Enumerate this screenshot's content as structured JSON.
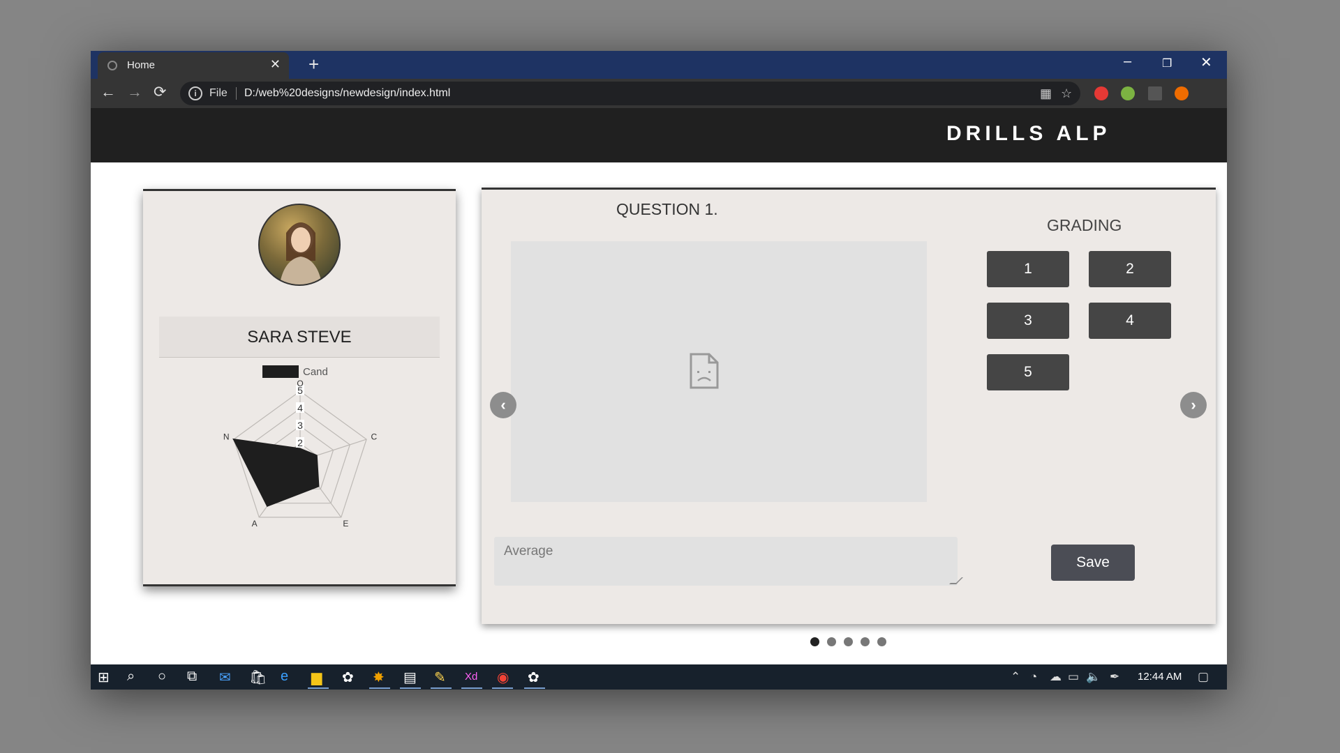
{
  "browser": {
    "tab_title": "Home",
    "tab_close": "✕",
    "new_tab": "+",
    "url_scheme": "File",
    "url": "D:/web%20designs/newdesign/index.html",
    "window_controls": [
      "–",
      "❐",
      "✕"
    ]
  },
  "page": {
    "brand": "DRILLS ALP"
  },
  "profile": {
    "name": "SARA STEVE"
  },
  "chart_data": {
    "type": "radar",
    "legend": [
      "Cand"
    ],
    "axes": [
      "O",
      "C",
      "E",
      "A",
      "N"
    ],
    "ticks": [
      "2",
      "3",
      "4",
      "5"
    ],
    "range": [
      1,
      5
    ],
    "series": [
      {
        "name": "Cand",
        "values": [
          1.7,
          2.0,
          2.8,
          4.2,
          5.0
        ],
        "color": "#1e1e1e"
      }
    ]
  },
  "question": {
    "title": "QUESTION 1.",
    "grading_title": "GRADING",
    "grades": [
      "1",
      "2",
      "3",
      "4",
      "5"
    ],
    "average_placeholder": "Average",
    "save_label": "Save",
    "prev_icon": "‹",
    "next_icon": "›"
  },
  "carousel": {
    "slide_count": 5,
    "active_index": 0
  },
  "taskbar": {
    "clock": "12:44 AM"
  },
  "colors": {
    "header_bg": "#202020",
    "card_bg": "#ede9e6",
    "button_bg": "#454545",
    "titlebar_bg": "#1e3363"
  }
}
